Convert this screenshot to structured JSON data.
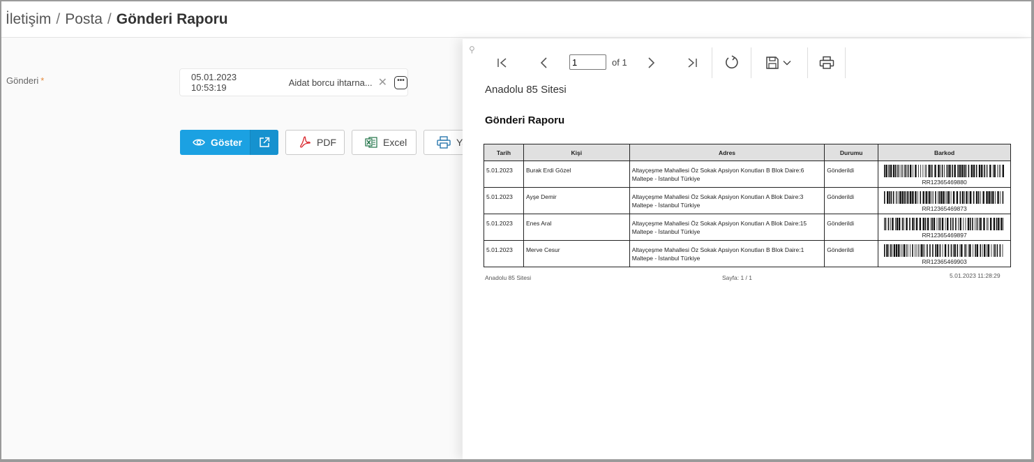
{
  "breadcrumb": {
    "items": [
      "İletişim",
      "Posta"
    ],
    "current": "Gönderi Raporu",
    "separator": "/"
  },
  "form": {
    "label": "Gönderi",
    "required_mark": "*",
    "lookup_date": "05.01.2023 10:53:19",
    "lookup_text": "Aidat borcu ihtarna...",
    "clear_glyph": "✕",
    "more_glyph": "•••"
  },
  "actions": {
    "show_label": "Göster",
    "pdf_label": "PDF",
    "excel_label": "Excel",
    "print_label": "Ya"
  },
  "viewer": {
    "page_value": "1",
    "page_of": "of 1",
    "pin_glyph": "⚲"
  },
  "report": {
    "company": "Anadolu 85 Sitesi",
    "title": "Gönderi Raporu",
    "columns": [
      "Tarih",
      "Kişi",
      "Adres",
      "Durumu",
      "Barkod"
    ],
    "rows": [
      {
        "date": "5.01.2023",
        "person": "Burak Erdi Gözel",
        "address_line1": "Altayçeşme Mahallesi Öz Sokak Apsiyon Konutları B Blok Daire:6",
        "address_line2": "Maltepe - İstanbul Türkiye",
        "status": "Gönderildi",
        "barcode": "RR12365469880"
      },
      {
        "date": "5.01.2023",
        "person": "Ayşe Demir",
        "address_line1": "Altayçeşme Mahallesi Öz Sokak Apsiyon Konutları A Blok Daire:3",
        "address_line2": "Maltepe - İstanbul Türkiye",
        "status": "Gönderildi",
        "barcode": "RR12365469873"
      },
      {
        "date": "5.01.2023",
        "person": "Enes Aral",
        "address_line1": "Altayçeşme Mahallesi Öz Sokak Apsiyon Konutları A Blok Daire:15",
        "address_line2": "Maltepe - İstanbul Türkiye",
        "status": "Gönderildi",
        "barcode": "RR12365469897"
      },
      {
        "date": "5.01.2023",
        "person": "Merve Cesur",
        "address_line1": "Altayçeşme Mahallesi Öz Sokak Apsiyon Konutları B Blok Daire:1",
        "address_line2": "Maltepe - İstanbul Türkiye",
        "status": "Gönderildi",
        "barcode": "RR12365469903"
      }
    ],
    "footer_left": "Anadolu 85 Sitesi",
    "footer_center": "Sayfa: 1 / 1",
    "footer_right": "5.01.2023 11:28:29"
  },
  "colors": {
    "primary": "#1ba1e2",
    "required": "#e58a3c",
    "pdf_red": "#d9262c",
    "excel_green": "#1e7145"
  }
}
